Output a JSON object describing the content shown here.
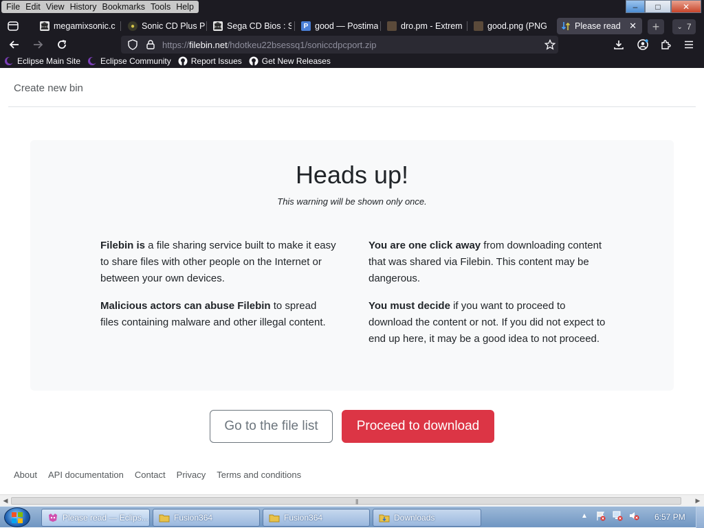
{
  "menubar": {
    "items": [
      "File",
      "Edit",
      "View",
      "History",
      "Bookmarks",
      "Tools",
      "Help"
    ],
    "accel": [
      "F",
      "E",
      "V",
      "H",
      "B",
      "T",
      "H"
    ]
  },
  "window_controls": {
    "minimize": "–",
    "maximize": "□",
    "close": "✕"
  },
  "tabs": [
    {
      "label": "megamixsonic.c",
      "icon": "archive-icon",
      "active": false
    },
    {
      "label": "Sonic CD Plus Pl",
      "icon": "sonic-ring-icon",
      "active": false
    },
    {
      "label": "Sega CD Bios : S",
      "icon": "archive-icon",
      "active": false
    },
    {
      "label": "good — Postima",
      "icon": "postimage-icon",
      "active": false
    },
    {
      "label": "dro.pm - Extrem",
      "icon": "image-thumb-icon",
      "active": false
    },
    {
      "label": "good.png (PNG",
      "icon": "image-thumb-icon",
      "active": false
    },
    {
      "label": "Please read",
      "icon": "filebin-icon",
      "active": true
    }
  ],
  "tab_count": "7",
  "url": {
    "scheme": "https://",
    "host": "filebin.net",
    "path": "/hdotkeu22bsessq1/soniccdpcport.zip"
  },
  "bookmarks": [
    {
      "label": "Eclipse Main Site",
      "icon": "eclipse-icon"
    },
    {
      "label": "Eclipse Community",
      "icon": "eclipse-icon"
    },
    {
      "label": "Report Issues",
      "icon": "github-icon"
    },
    {
      "label": "Get New Releases",
      "icon": "github-icon"
    }
  ],
  "page": {
    "nav_link": "Create new bin",
    "heading": "Heads up!",
    "subtitle": "This warning will be shown only once.",
    "left": [
      {
        "bold": "Filebin is",
        "text": " a file sharing service built to make it easy to share files with other people on the Internet or between your own devices."
      },
      {
        "bold": "Malicious actors can abuse Filebin",
        "text": " to spread files containing malware and other illegal content."
      }
    ],
    "right": [
      {
        "bold": "You are one click away",
        "text": " from downloading content that was shared via Filebin. This content may be dangerous."
      },
      {
        "bold": "You must decide",
        "text": " if you want to proceed to download the content or not. If you did not expect to end up here, it may be a good idea to not proceed."
      }
    ],
    "buttons": {
      "file_list": "Go to the file list",
      "proceed": "Proceed to download"
    },
    "footer": [
      "About",
      "API documentation",
      "Contact",
      "Privacy",
      "Terms and conditions"
    ]
  },
  "taskbar": {
    "items": [
      {
        "label": "Please read — Eclips...",
        "icon": "browser-icon",
        "active": true
      },
      {
        "label": "Fusion364",
        "icon": "folder-icon",
        "active": false
      },
      {
        "label": "Fusion364",
        "icon": "folder-icon",
        "active": false
      },
      {
        "label": "Downloads",
        "icon": "downloads-folder-icon",
        "active": false
      }
    ],
    "clock": "6:57 PM"
  },
  "colors": {
    "chrome_bg": "#1c1b22",
    "urlbar_bg": "#2b2a33",
    "danger": "#dc3545",
    "secondary": "#6c757d",
    "card_bg": "#f8f9fa"
  }
}
